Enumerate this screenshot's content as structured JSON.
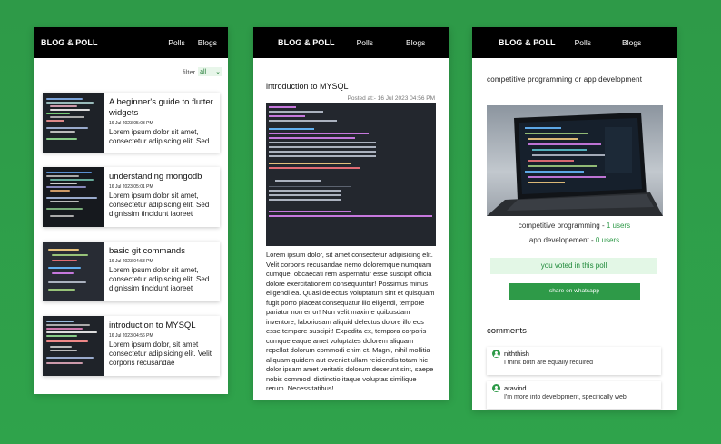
{
  "screen1": {
    "brand": "BLOG & POLL",
    "nav": [
      "Polls",
      "Blogs"
    ],
    "filter_label": "filter",
    "filter_value": "all",
    "cards": [
      {
        "title": "A beginner's guide to flutter widgets",
        "date": "16 Jul 2023 05:03 PM",
        "excerpt": "Lorem ipsum dolor sit amet, consectetur adipiscing elit. Sed"
      },
      {
        "title": "understanding mongodb",
        "date": "16 Jul 2023 05:01 PM",
        "excerpt": "Lorem ipsum dolor sit amet, consectetur adipiscing elit. Sed dignissim tincidunt iaoreet"
      },
      {
        "title": "basic git commands",
        "date": "16 Jul 2023 04:58 PM",
        "excerpt": "Lorem ipsum dolor sit amet, consectetur adipiscing elit. Sed dignissim tincidunt iaoreet"
      },
      {
        "title": "introduction to MYSQL",
        "date": "16 Jul 2023 04:56 PM",
        "excerpt": "Lorem ipsum dolor, sit amet consectetur adipisicing elit. Velit corporis recusandae"
      }
    ]
  },
  "screen2": {
    "brand": "BLOG & POLL",
    "nav": [
      "Polls",
      "Blogs"
    ],
    "title": "introduction to MYSQL",
    "meta": "Posted at:- 16 Jul 2023 04:56 PM",
    "body": "Lorem ipsum dolor, sit amet consectetur adipisicing elit. Velit corporis recusandae nemo doloremque numquam cumque, obcaecati rem aspernatur esse suscipit officia dolore exercitationem consequuntur! Possimus minus eligendi ea. Quasi delectus voluptatum sint et quisquam fugit porro placeat consequatur illo eligendi, tempore pariatur non error! Non velit maxime quibusdam inventore, laboriosam aliquid delectus dolore illo eos esse tempore suscipit! Expedita ex, tempora corporis cumque eaque amet voluptates dolorem aliquam repellat dolorum commodi enim et. Magni, nihil mollitia aliquam quidem aut eveniet ullam reiciendis totam hic dolor ipsam amet veritatis dolorum deserunt sint, saepe nobis commodi distinctio itaque voluptas similique rerum. Necessitatibus!"
  },
  "screen3": {
    "brand": "BLOG & POLL",
    "nav": [
      "Polls",
      "Blogs"
    ],
    "question": "competitive programming or app development",
    "options": [
      {
        "label": "competitive programming - ",
        "count": "1 users"
      },
      {
        "label": "app developement - ",
        "count": "0 users"
      }
    ],
    "voted_text": "you voted in this poll",
    "share_label": "share on whatsapp",
    "comments_heading": "comments",
    "comments": [
      {
        "user": "niththish",
        "text": "I think both are equally required"
      },
      {
        "user": "aravind",
        "text": "I'm more into development, specifically web"
      }
    ]
  }
}
